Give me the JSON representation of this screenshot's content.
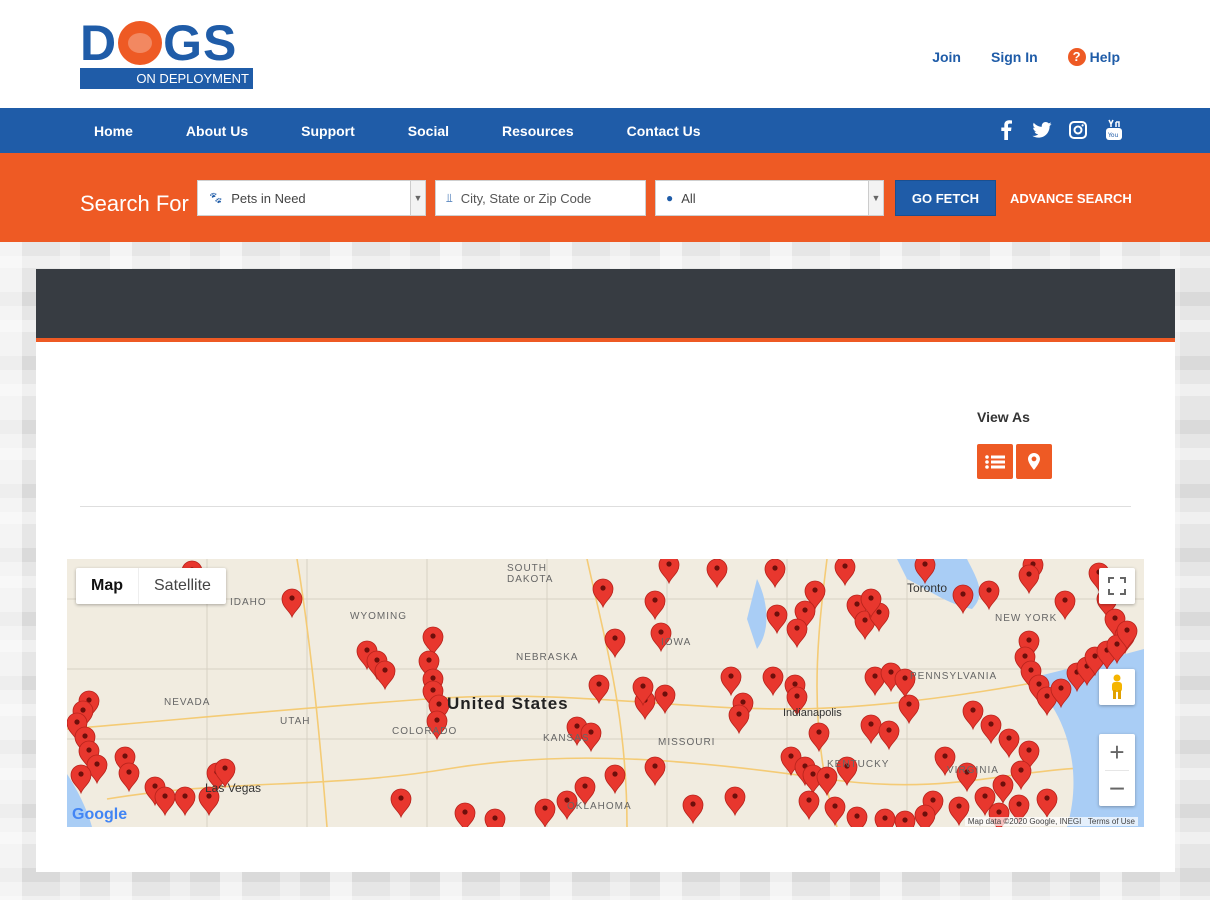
{
  "brand": {
    "logo_main": "DOGS",
    "logo_sub": "ON DEPLOYMENT",
    "primary": "#1f5ca8",
    "accent": "#ee5a24"
  },
  "top_links": {
    "join": "Join",
    "sign_in": "Sign In",
    "help": "Help"
  },
  "nav": [
    "Home",
    "About Us",
    "Support",
    "Social",
    "Resources",
    "Contact Us"
  ],
  "social_icons": [
    "facebook-icon",
    "twitter-icon",
    "instagram-icon",
    "youtube-icon"
  ],
  "search": {
    "label": "Search For",
    "category": "Pets in Need",
    "location_placeholder": "City, State or Zip Code",
    "filter": "All",
    "go": "GO FETCH",
    "advanced": "ADVANCE SEARCH"
  },
  "view_as": "View As",
  "map": {
    "map_button": "Map",
    "satellite_button": "Satellite",
    "attribution": "Map data ©2020 Google, INEGI",
    "terms": "Terms of Use",
    "google": "Google",
    "labels": [
      "SOUTH DAKOTA",
      "WYOMING",
      "NEBRASKA",
      "NEVADA",
      "UTAH",
      "COLORADO",
      "KANSAS",
      "MISSOURI",
      "IDAHO",
      "United States",
      "Toronto",
      "NEW YORK",
      "Las Vegas",
      "Indianapolis",
      "PENNSYLVANIA",
      "OKLAHOMA",
      "KENTUCKY",
      "VIRGINIA",
      "IOWA"
    ]
  }
}
